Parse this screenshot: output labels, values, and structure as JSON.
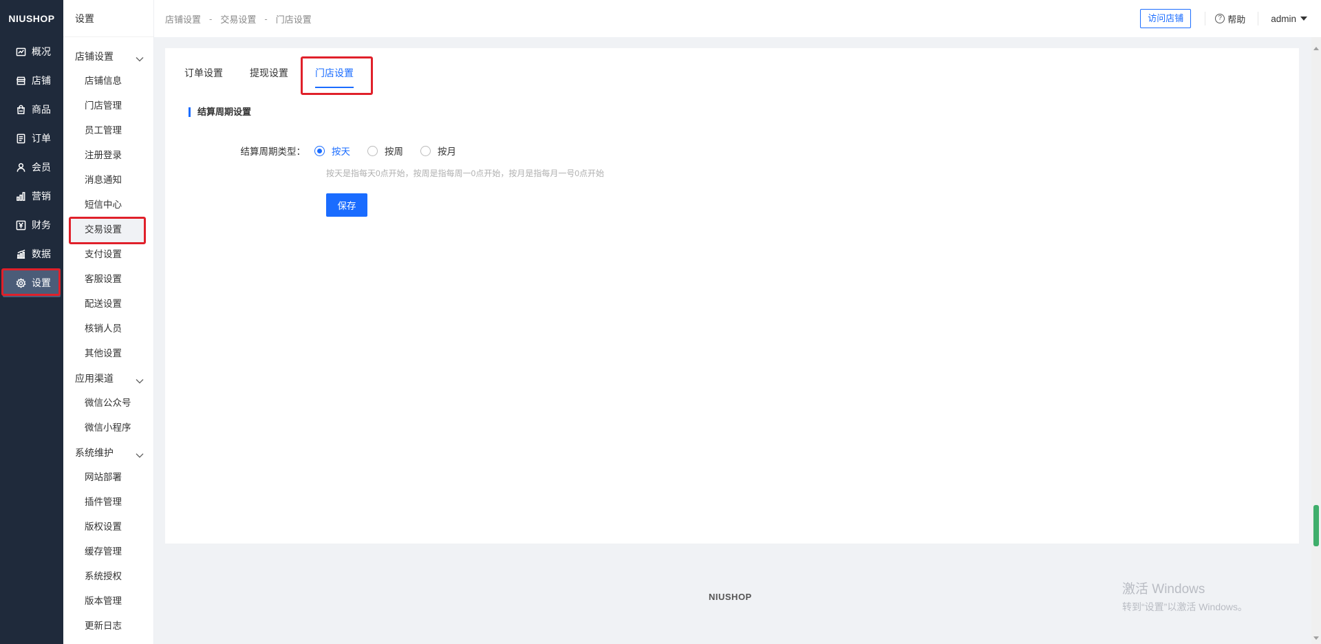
{
  "nav": {
    "logo": "NIUSHOP",
    "items": [
      {
        "label": "概况",
        "icon": "chart-line-icon"
      },
      {
        "label": "店铺",
        "icon": "store-icon"
      },
      {
        "label": "商品",
        "icon": "bag-icon"
      },
      {
        "label": "订单",
        "icon": "document-icon"
      },
      {
        "label": "会员",
        "icon": "user-icon"
      },
      {
        "label": "营销",
        "icon": "bar-chart-icon"
      },
      {
        "label": "财务",
        "icon": "yen-icon"
      },
      {
        "label": "数据",
        "icon": "data-chart-icon"
      },
      {
        "label": "设置",
        "icon": "gear-icon"
      }
    ],
    "active": "设置"
  },
  "subnav": {
    "title": "设置",
    "groups": [
      {
        "label": "店铺设置",
        "items": [
          "店铺信息",
          "门店管理",
          "员工管理",
          "注册登录",
          "消息通知",
          "短信中心",
          "交易设置",
          "支付设置",
          "客服设置",
          "配送设置",
          "核销人员",
          "其他设置"
        ]
      },
      {
        "label": "应用渠道",
        "items": [
          "微信公众号",
          "微信小程序"
        ]
      },
      {
        "label": "系统维护",
        "items": [
          "网站部署",
          "插件管理",
          "版权设置",
          "缓存管理",
          "系统授权",
          "版本管理",
          "更新日志"
        ]
      }
    ],
    "active": "交易设置"
  },
  "header": {
    "breadcrumbs": [
      "店铺设置",
      "交易设置",
      "门店设置"
    ],
    "separator": "-",
    "visit_label": "访问店铺",
    "help_label": "帮助",
    "help_icon": "?",
    "user_label": "admin"
  },
  "tabs": {
    "items": [
      "订单设置",
      "提现设置",
      "门店设置"
    ],
    "active": "门店设置"
  },
  "section": {
    "title": "结算周期设置"
  },
  "form": {
    "label": "结算周期类型：",
    "options": [
      "按天",
      "按周",
      "按月"
    ],
    "selected": "按天",
    "hint": "按天是指每天0点开始，按周是指每周一0点开始，按月是指每月一号0点开始",
    "save_label": "保存"
  },
  "footer": {
    "logo": "NIUSHOP"
  },
  "watermark": {
    "line1": "激活 Windows",
    "line2": "转到“设置”以激活 Windows。"
  },
  "colors": {
    "accent": "#1a6cff",
    "nav_bg": "#1f2a3b",
    "highlight": "#e0202a"
  }
}
